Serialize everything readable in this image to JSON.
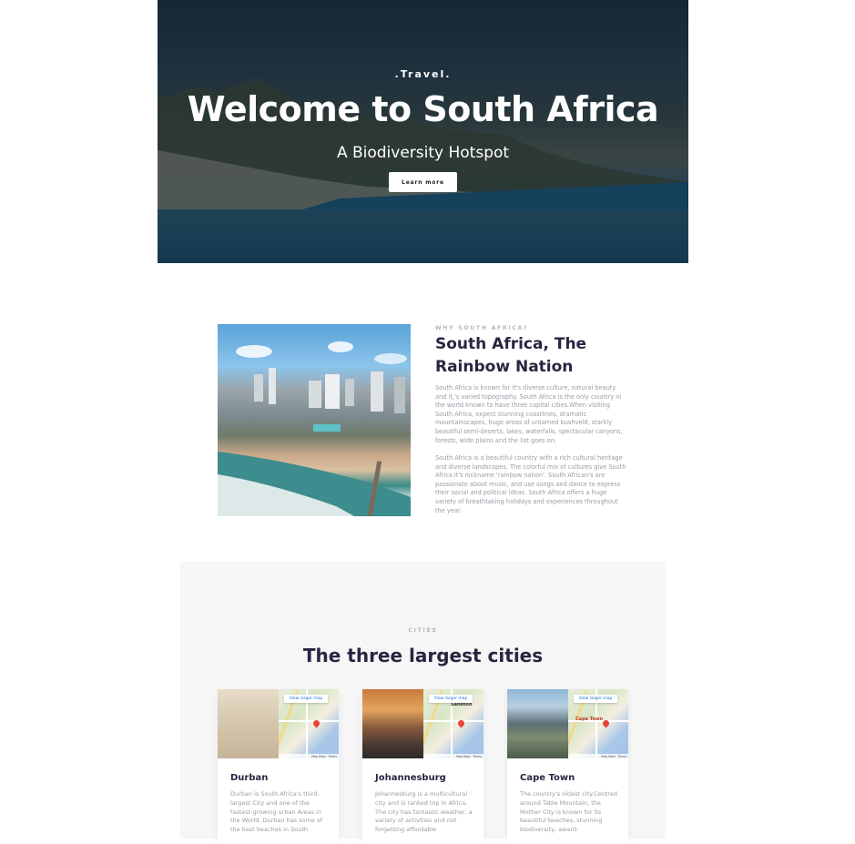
{
  "hero": {
    "kicker": ".Travel.",
    "title": "Welcome to South Africa",
    "subtitle": "A Biodiversity Hotspot",
    "button": "Learn more"
  },
  "about": {
    "eyebrow": "WHY SOUTH AFRICA?",
    "title": "South Africa, The Rainbow Nation",
    "p1": "South Africa is known for it's diverse culture, natural beauty and it,'s varied topography. South Africa is the only country in the world known to have three capital cities.When visiting South Africa, expect stunning coastlines, dramatic mountainscapes, huge areas of untamed bushveld, starkly beautiful semi-deserts, lakes, waterfalls, spectacular canyons, forests, wide plains and the list goes on.",
    "p2": "South Africa is a beautiful country with a rich cultural heritage and diverse landscapes. The colorful mix of cultures give South Africa it's nickname 'rainbow nation'. South African's are passionate about music, and use songs and dance to express their social and political ideas. South Africa offers a huge variety of breathtaking holidays and experiences throughout the year."
  },
  "cities": {
    "eyebrow": "CITIES",
    "title": "The three largest cities",
    "map_link": "View larger map",
    "map_footer": [
      "Map Data",
      "Terms"
    ],
    "items": [
      {
        "name": "Durban",
        "desc": "Durban is South Africa's third-largest City and one of the fastest-growing urban Areas in the World. Durban has some of the best beaches in South",
        "map_label": ""
      },
      {
        "name": "Johannesburg",
        "desc": "Johannesburg is a multicultural city and is ranked top in Africa. The city has fantastic weather, a variety of activities and not forgetting affordable",
        "map_label": "Sandton"
      },
      {
        "name": "Cape Town",
        "desc": "The country's oldest city.Centred around Table Mountain, the Mother City is known for its beautiful beaches, stunning biodiversity, award-",
        "map_label": "Cape Town"
      }
    ]
  }
}
